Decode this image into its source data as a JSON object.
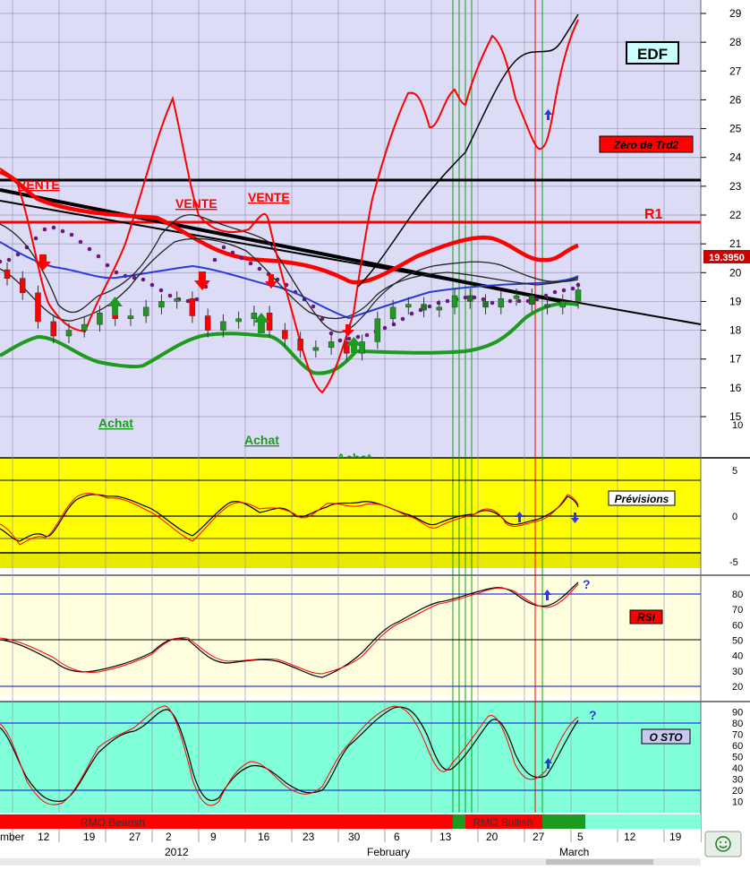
{
  "title_box": "EDF",
  "last_price": "19.3950",
  "badges": {
    "zero": "Zéro de Trd2",
    "previsions": "Prévisions",
    "rsi": "RSI",
    "osto": "O STO"
  },
  "level_labels": {
    "r1": "R1"
  },
  "signals": {
    "vente": [
      "VENTE",
      "VENTE",
      "VENTE"
    ],
    "achat": [
      "Achat",
      "Achat",
      "Achat"
    ]
  },
  "rmo": {
    "bearish": "RMO Bearish",
    "bullish": "RMO Bullish"
  },
  "date_axis": {
    "ticks": [
      "mber",
      "12",
      "19",
      "27",
      "2012",
      "9",
      "16",
      "23",
      "30",
      "February",
      "13",
      "20",
      "27",
      "March",
      "12",
      "19"
    ],
    "extra": [
      "2",
      "6",
      "5"
    ]
  },
  "smiley_icon": "smiley-icon",
  "colors": {
    "price_bg": "#dcdcf7",
    "prev_bg": "#ffff00",
    "rsi_bg": "#ffffe0",
    "sto_bg": "#80ffd8",
    "red": "#ff0000",
    "green": "#1e9a1e",
    "blue": "#2a3ad8",
    "purple": "#6a1a7a",
    "black": "#000000"
  },
  "chart_data": [
    {
      "type": "line",
      "panel": "price",
      "y_ticks": [
        29,
        28,
        27,
        26,
        25,
        24,
        23,
        22,
        21,
        20,
        19,
        18,
        17,
        16,
        15
      ],
      "ylim": [
        14,
        29.5
      ],
      "levels": [
        {
          "name": "R1",
          "value": 20.6,
          "color": "#ff0000"
        },
        {
          "name": "",
          "value": 22.1,
          "color": "#000000"
        }
      ],
      "current_price": 19.395,
      "series_points": {
        "close": [
          19.8,
          19.3,
          18.3,
          17.8,
          18.0,
          18.2,
          18.6,
          18.4,
          18.5,
          18.8,
          19.0,
          19.1,
          18.5,
          18.0,
          18.3,
          18.4,
          18.6,
          18.0,
          17.7,
          17.3,
          17.4,
          17.6,
          17.2,
          17.6,
          18.4,
          18.8,
          18.9,
          18.7,
          18.8,
          19.2,
          19.0,
          18.8,
          19.1,
          19.2,
          18.9,
          18.8,
          19.0,
          19.4
        ]
      }
    },
    {
      "type": "line",
      "panel": "previsions",
      "y_ticks": [
        10,
        5,
        0,
        -5
      ],
      "ylim": [
        -9,
        12
      ]
    },
    {
      "type": "line",
      "panel": "RSI",
      "y_ticks": [
        80,
        70,
        60,
        50,
        40,
        30,
        20
      ],
      "ylim": [
        14,
        88
      ],
      "hlines": [
        80,
        50,
        20
      ]
    },
    {
      "type": "line",
      "panel": "O STO",
      "y_ticks": [
        90,
        80,
        70,
        60,
        50,
        40,
        30,
        20,
        10
      ],
      "ylim": [
        3,
        98
      ],
      "hlines": [
        80,
        20
      ]
    }
  ]
}
